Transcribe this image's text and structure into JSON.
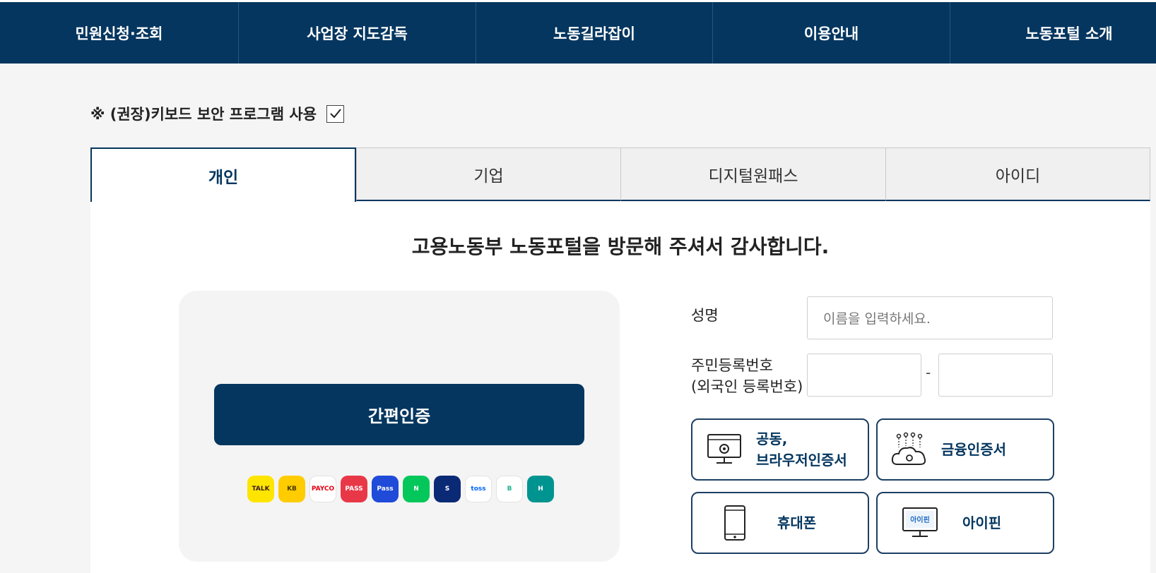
{
  "nav": {
    "items": [
      {
        "label": "민원신청·조회"
      },
      {
        "label": "사업장 지도감독"
      },
      {
        "label": "노동길라잡이"
      },
      {
        "label": "이용안내"
      },
      {
        "label": "노동포털 소개"
      }
    ]
  },
  "notice": {
    "text": "※ (권장)키보드 보안 프로그램 사용",
    "checked": true
  },
  "tabs": [
    {
      "label": "개인",
      "active": true
    },
    {
      "label": "기업",
      "active": false
    },
    {
      "label": "디지털원패스",
      "active": false
    },
    {
      "label": "아이디",
      "active": false
    }
  ],
  "welcome": "고용노동부 노동포털을 방문해 주셔서 감사합니다.",
  "easy_auth": {
    "button_label": "간편인증",
    "providers": [
      {
        "name": "kakao",
        "text": "TALK",
        "bg": "#fee500",
        "fg": "#3a1d1d"
      },
      {
        "name": "kb",
        "text": "KB",
        "bg": "#ffcc00",
        "fg": "#4a3b00"
      },
      {
        "name": "payco",
        "text": "PAYCO",
        "bg": "#ffffff",
        "fg": "#e60012"
      },
      {
        "name": "pass",
        "text": "PASS",
        "bg": "#e83848",
        "fg": "#ffffff"
      },
      {
        "name": "samsung-pass",
        "text": "Pass",
        "bg": "#1f4bd8",
        "fg": "#ffffff"
      },
      {
        "name": "naver",
        "text": "N",
        "bg": "#03c75a",
        "fg": "#ffffff"
      },
      {
        "name": "shinhan",
        "text": "S",
        "bg": "#0b2a75",
        "fg": "#ffffff"
      },
      {
        "name": "toss",
        "text": "toss",
        "bg": "#ffffff",
        "fg": "#0064ff"
      },
      {
        "name": "banksalad",
        "text": "B",
        "bg": "#ffffff",
        "fg": "#1cb58c"
      },
      {
        "name": "hana",
        "text": "H",
        "bg": "#009490",
        "fg": "#ffffff"
      }
    ]
  },
  "form": {
    "name_label": "성명",
    "name_placeholder": "이름을 입력하세요.",
    "rrn_label_1": "주민등록번호",
    "rrn_label_2": "(외국인 등록번호)",
    "dash": "-"
  },
  "cert_buttons": {
    "joint_1": "공동,",
    "joint_2": "브라우저인증서",
    "financial": "금융인증서",
    "phone": "휴대폰",
    "ipin": "아이핀",
    "ipin_screen": "아이핀"
  },
  "colors": {
    "brand": "#04365f",
    "background": "#f5f5f5"
  }
}
